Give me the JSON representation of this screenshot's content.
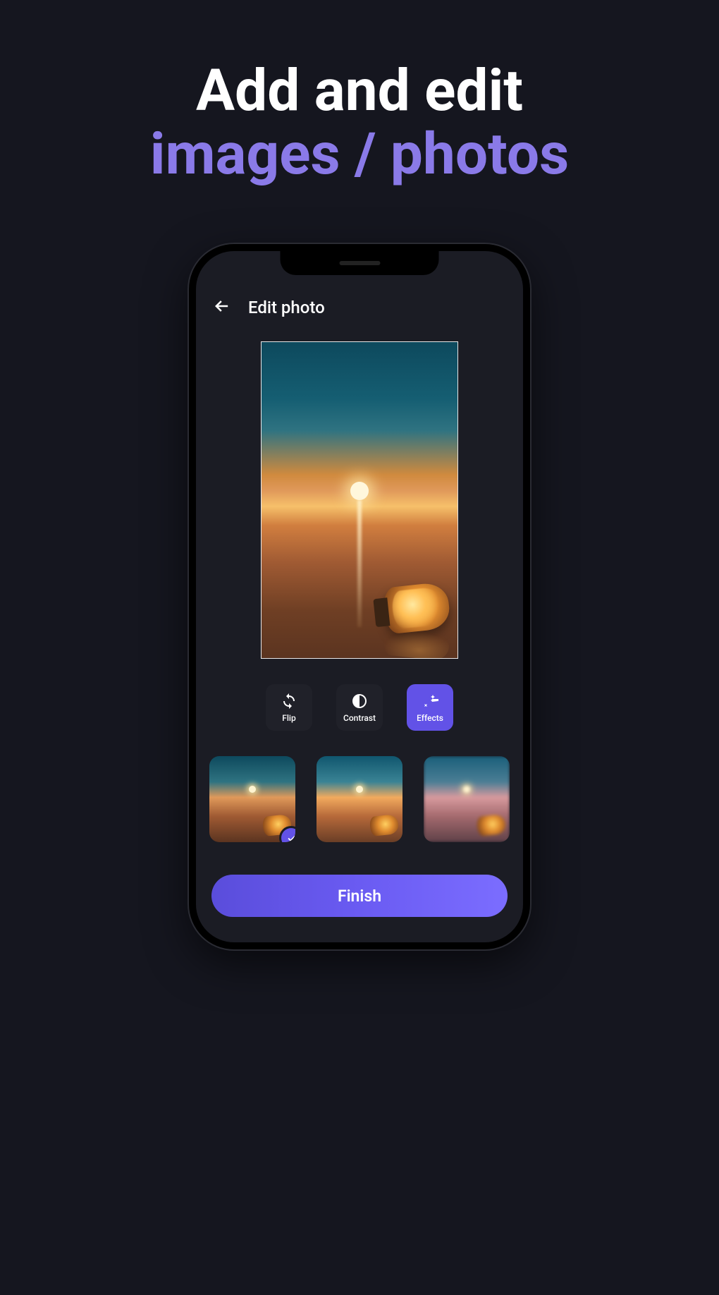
{
  "promo": {
    "line1": "Add and edit",
    "line2": "images / photos"
  },
  "header": {
    "title": "Edit photo"
  },
  "tools": {
    "flip": "Flip",
    "contrast": "Contrast",
    "effects": "Effects"
  },
  "thumbnails": {
    "selected_index": 0
  },
  "actions": {
    "finish": "Finish"
  },
  "colors": {
    "accent": "#6252e7",
    "bg": "#15161f",
    "screen": "#1b1c24"
  }
}
